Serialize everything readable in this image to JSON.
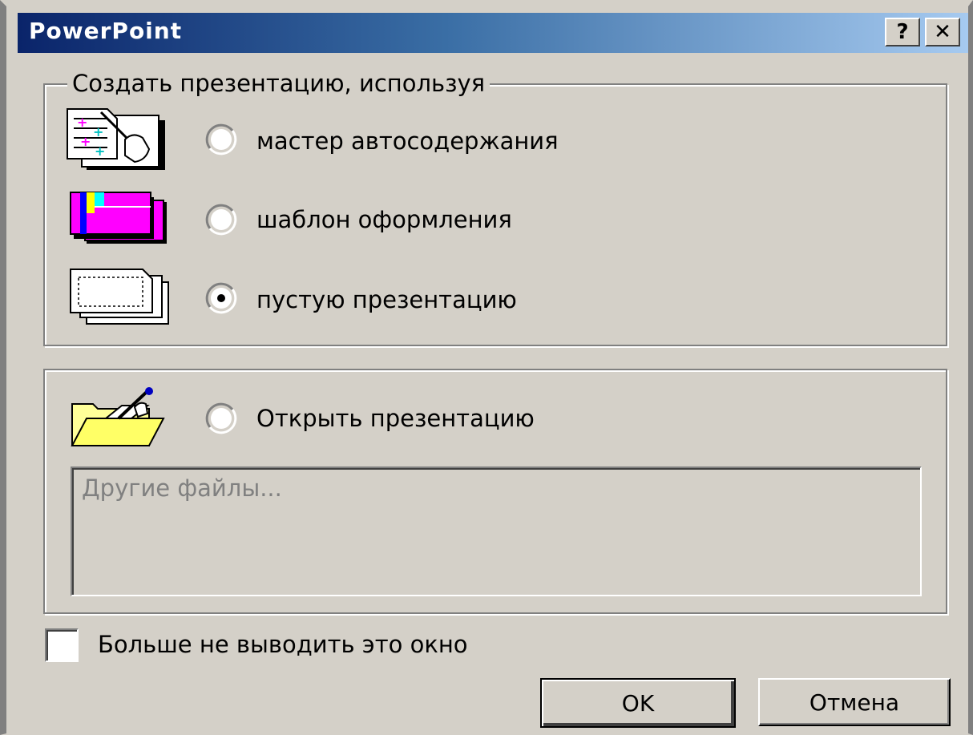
{
  "window": {
    "title": "PowerPoint",
    "help_label": "?",
    "close_label": "✕"
  },
  "create_group": {
    "legend": "Создать презентацию, используя",
    "options": [
      {
        "label": "мастер автосодержания",
        "icon": "autocontent-wizard-icon",
        "selected": false
      },
      {
        "label": "шаблон оформления",
        "icon": "design-template-icon",
        "selected": false
      },
      {
        "label": "пустую презентацию",
        "icon": "blank-presentation-icon",
        "selected": true
      }
    ]
  },
  "open_group": {
    "option": {
      "label": "Открыть презентацию",
      "icon": "open-folder-icon",
      "selected": false
    },
    "file_list": [
      "Другие файлы..."
    ]
  },
  "dont_show": {
    "label": "Больше не выводить это окно",
    "checked": false
  },
  "buttons": {
    "ok": "OK",
    "cancel": "Отмена"
  }
}
